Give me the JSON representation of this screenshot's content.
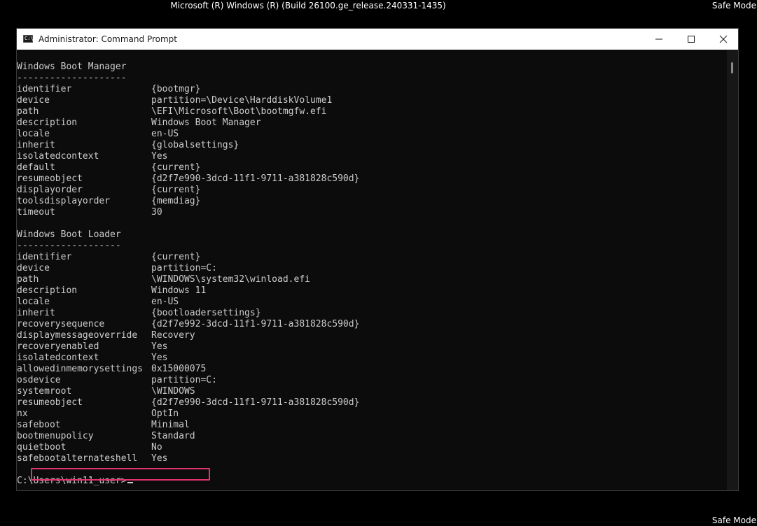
{
  "desktop": {
    "build_text": "Microsoft (R) Windows (R) (Build 26100.ge_release.240331-1435)",
    "safe_mode_label": "Safe Mode"
  },
  "window": {
    "title": "Administrator: Command Prompt",
    "icon": "cmd-icon",
    "icon_glyph": "C:\\"
  },
  "console": {
    "lines": [
      {
        "key": "Windows Boot Manager",
        "value": ""
      },
      {
        "key": "--------------------",
        "value": ""
      },
      {
        "key": "identifier",
        "value": "{bootmgr}"
      },
      {
        "key": "device",
        "value": "partition=\\Device\\HarddiskVolume1"
      },
      {
        "key": "path",
        "value": "\\EFI\\Microsoft\\Boot\\bootmgfw.efi"
      },
      {
        "key": "description",
        "value": "Windows Boot Manager"
      },
      {
        "key": "locale",
        "value": "en-US"
      },
      {
        "key": "inherit",
        "value": "{globalsettings}"
      },
      {
        "key": "isolatedcontext",
        "value": "Yes"
      },
      {
        "key": "default",
        "value": "{current}"
      },
      {
        "key": "resumeobject",
        "value": "{d2f7e990-3dcd-11f1-9711-a381828c590d}"
      },
      {
        "key": "displayorder",
        "value": "{current}"
      },
      {
        "key": "toolsdisplayorder",
        "value": "{memdiag}"
      },
      {
        "key": "timeout",
        "value": "30"
      },
      {
        "key": "",
        "value": ""
      },
      {
        "key": "Windows Boot Loader",
        "value": ""
      },
      {
        "key": "-------------------",
        "value": ""
      },
      {
        "key": "identifier",
        "value": "{current}"
      },
      {
        "key": "device",
        "value": "partition=C:"
      },
      {
        "key": "path",
        "value": "\\WINDOWS\\system32\\winload.efi"
      },
      {
        "key": "description",
        "value": "Windows 11"
      },
      {
        "key": "locale",
        "value": "en-US"
      },
      {
        "key": "inherit",
        "value": "{bootloadersettings}"
      },
      {
        "key": "recoverysequence",
        "value": "{d2f7e992-3dcd-11f1-9711-a381828c590d}"
      },
      {
        "key": "displaymessageoverride",
        "value": "Recovery"
      },
      {
        "key": "recoveryenabled",
        "value": "Yes"
      },
      {
        "key": "isolatedcontext",
        "value": "Yes"
      },
      {
        "key": "allowedinmemorysettings",
        "value": "0x15000075"
      },
      {
        "key": "osdevice",
        "value": "partition=C:"
      },
      {
        "key": "systemroot",
        "value": "\\WINDOWS"
      },
      {
        "key": "resumeobject",
        "value": "{d2f7e990-3dcd-11f1-9711-a381828c590d}"
      },
      {
        "key": "nx",
        "value": "OptIn"
      },
      {
        "key": "safeboot",
        "value": "Minimal"
      },
      {
        "key": "bootmenupolicy",
        "value": "Standard"
      },
      {
        "key": "quietboot",
        "value": "No"
      },
      {
        "key": "safebootalternateshell",
        "value": "Yes"
      },
      {
        "key": "",
        "value": ""
      }
    ],
    "prompt": "C:\\Users\\win11_user>"
  },
  "colors": {
    "console_bg": "#0c0c0c",
    "console_text": "#cccccc",
    "highlight": "#e3336b"
  }
}
